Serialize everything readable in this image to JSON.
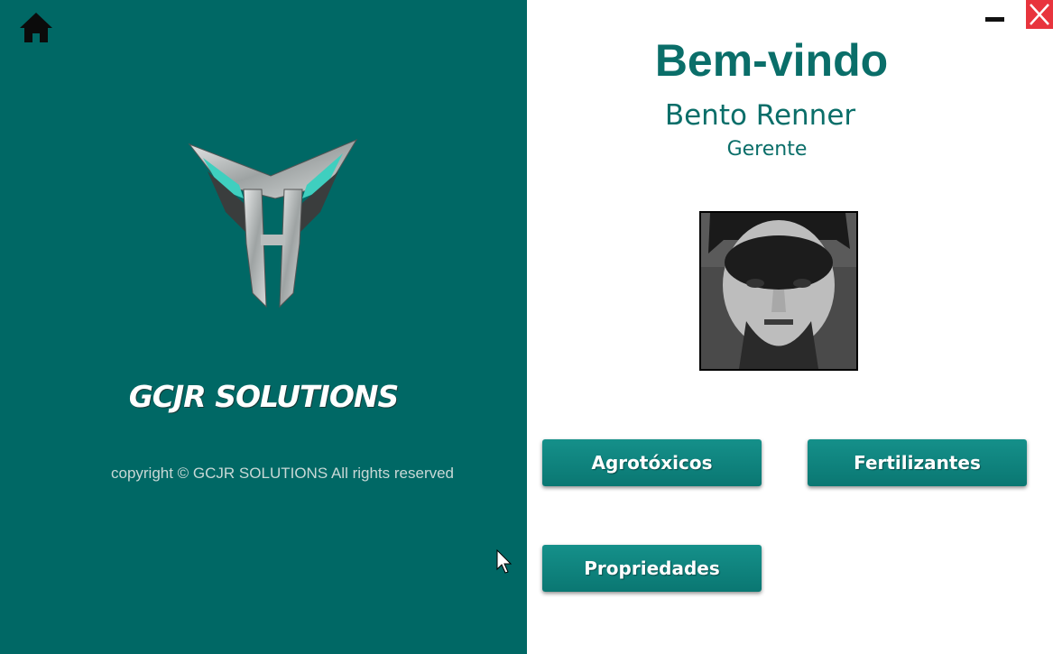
{
  "sidebar": {
    "brand": "GCJR SOLUTIONS",
    "copyright": "copyright © GCJR SOLUTIONS All rights reserved",
    "home_icon": "home-icon",
    "logo_icon": "gcjr-logo"
  },
  "window": {
    "minimize_icon": "minimize-icon",
    "close_icon": "close-icon",
    "close_color": "#e8343d"
  },
  "welcome": {
    "title": "Bem-vindo",
    "user_name": "Bento Renner",
    "user_role": "Gerente"
  },
  "menu": {
    "agrotoxicos": "Agrotóxicos",
    "fertilizantes": "Fertilizantes",
    "propriedades": "Propriedades"
  },
  "colors": {
    "sidebar_bg": "#006865",
    "accent": "#0a6e69",
    "button": "#0f827d"
  }
}
